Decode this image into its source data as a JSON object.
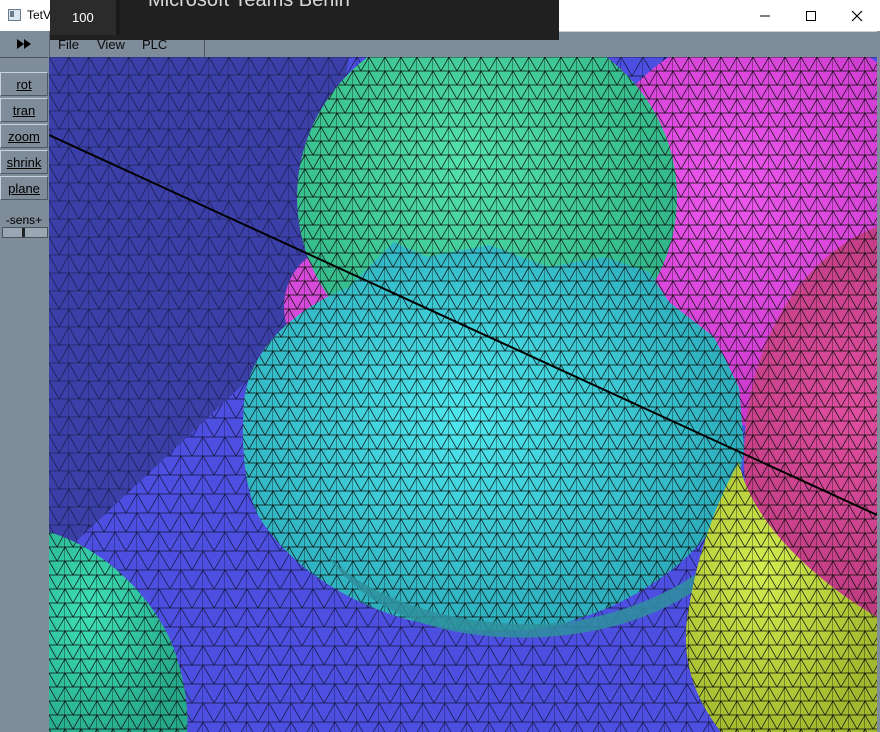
{
  "window": {
    "title": "TetView"
  },
  "overlay": {
    "participant_count": "100",
    "text": "Microsoft Teams Berlin"
  },
  "menu": {
    "file": "File",
    "view": "View",
    "plc": "PLC"
  },
  "toolbar": {
    "play_icon": "fast-forward-icon",
    "rot": "rot",
    "tran": "tran",
    "zoom": "zoom",
    "shrink": "shrink",
    "plane": "plane",
    "sens_label": "-sens+"
  },
  "colors": {
    "background": "#4c4fe0",
    "wall": "#3b3fa8",
    "green_sphere": "#44d6a0",
    "magenta_sphere": "#e245e6",
    "cyan_sphere": "#3fd4e0",
    "pink_sphere": "#d0408a",
    "yellow_sphere": "#c6e040",
    "left_sphere": "#37d8b0",
    "mesh_line": "#111111"
  }
}
